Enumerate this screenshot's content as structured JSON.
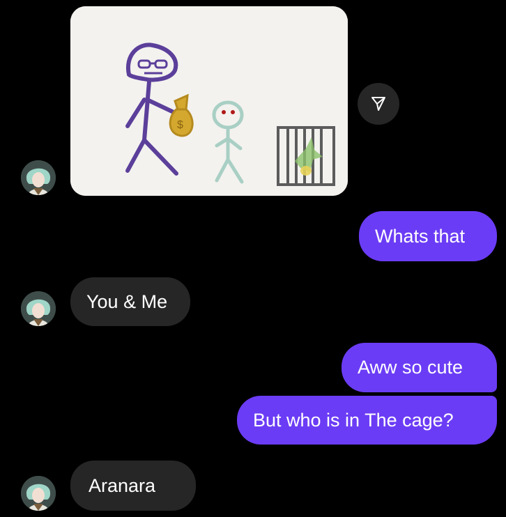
{
  "messages": [
    {
      "from": "them",
      "type": "image",
      "image_description_icon": "stick-figure-drawing"
    },
    {
      "from": "me",
      "text": "Whats that"
    },
    {
      "from": "them",
      "text": "You & Me"
    },
    {
      "from": "me",
      "text": "Aww so cute"
    },
    {
      "from": "me",
      "text": "But who is in The cage?"
    },
    {
      "from": "them",
      "text": "Aranara"
    }
  ],
  "colors": {
    "background": "#000000",
    "incoming_bubble": "#262626",
    "outgoing_bubble": "#6b3cf5",
    "text": "#ffffff"
  },
  "icons": {
    "share": "paper-plane-icon",
    "avatar": "anime-avatar"
  }
}
